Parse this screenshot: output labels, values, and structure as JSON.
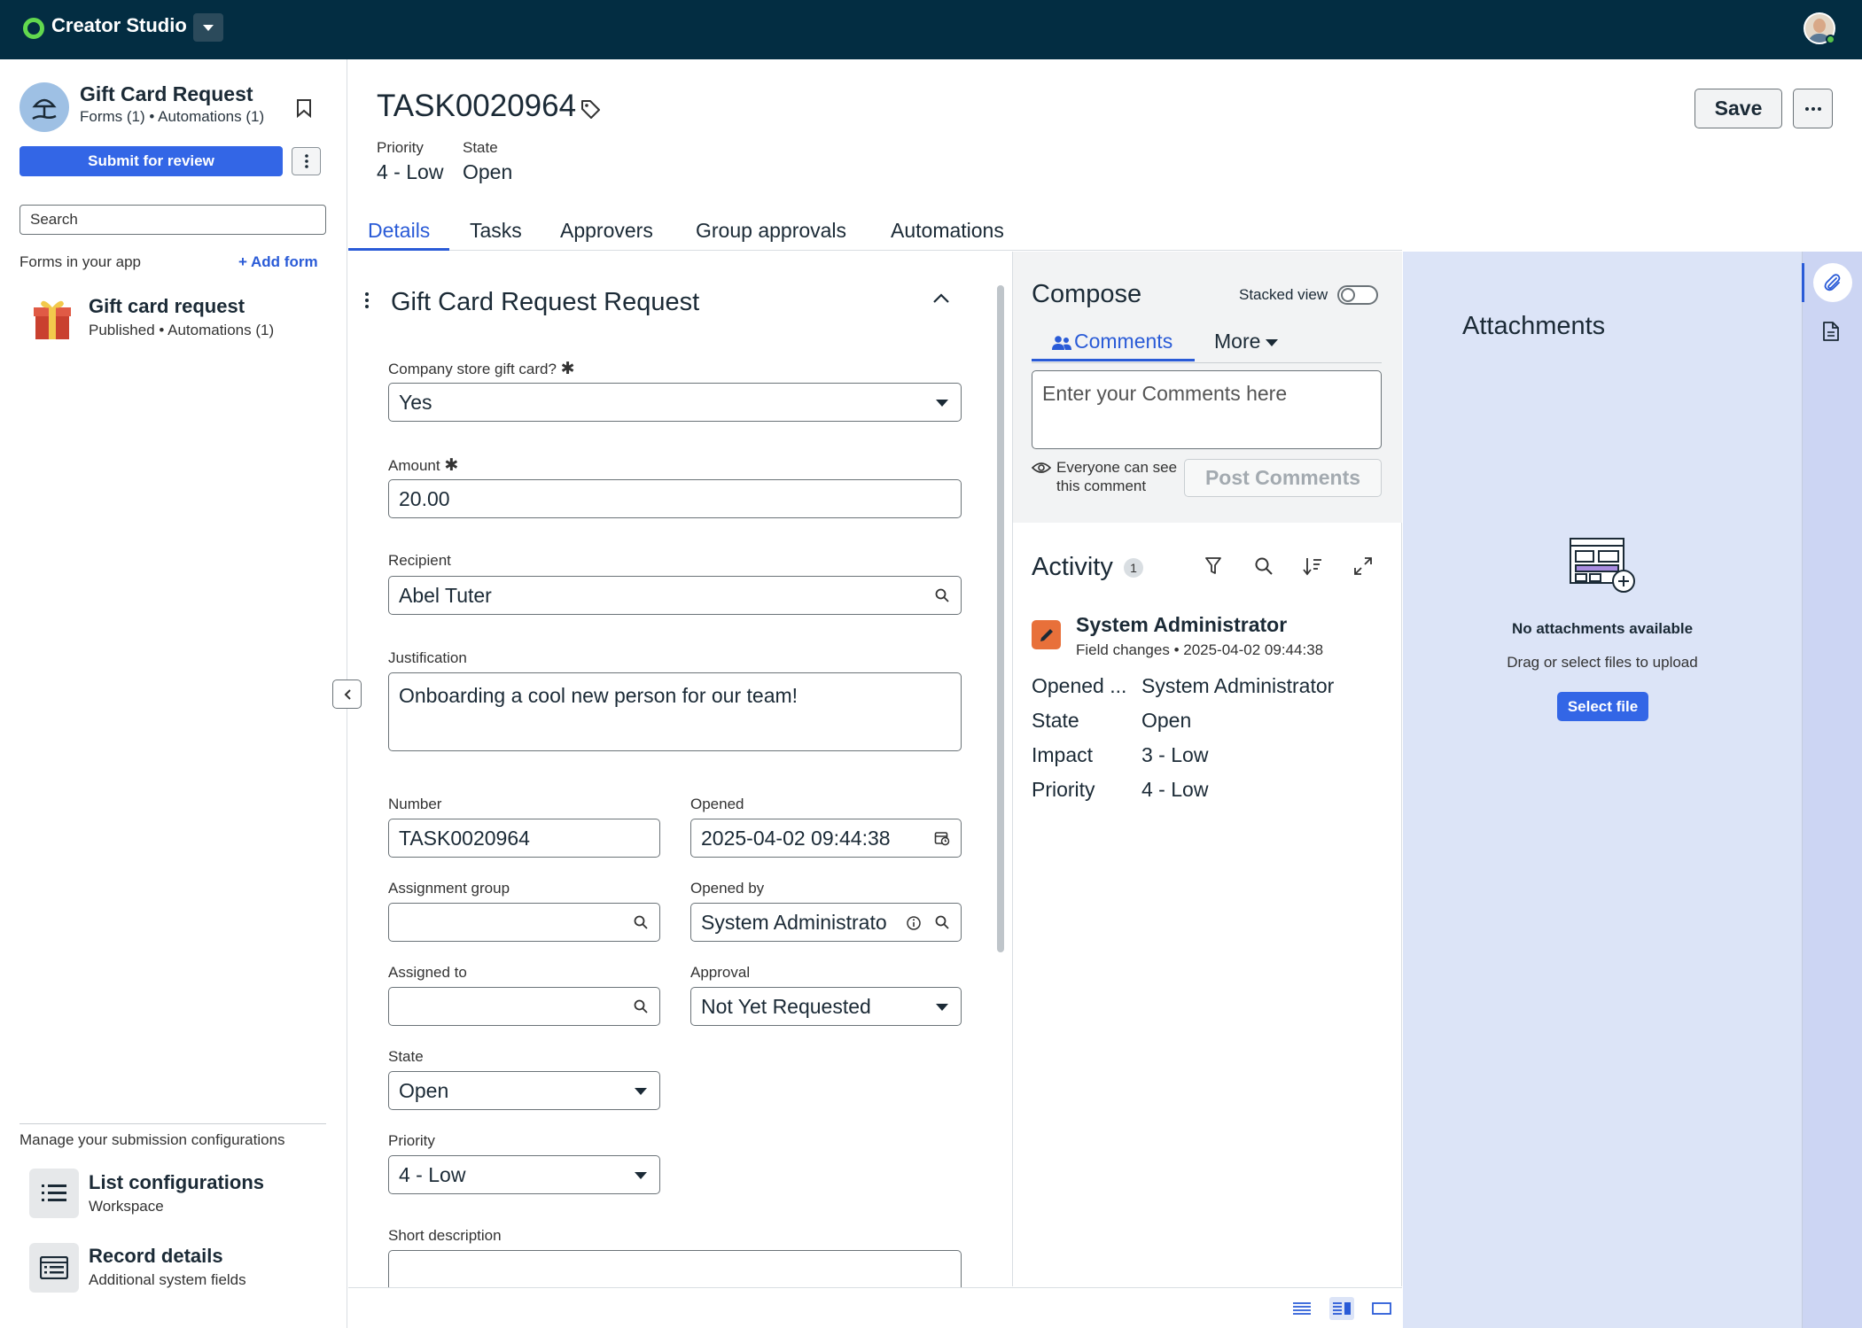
{
  "topbar": {
    "brand": "Creator Studio"
  },
  "sidebar": {
    "app_title": "Gift Card Request",
    "app_sub": "Forms (1) • Automations (1)",
    "submit_label": "Submit for review",
    "search_placeholder": "Search",
    "forms_label": "Forms in your app",
    "add_form_label": "+ Add form",
    "form_item": {
      "title": "Gift card request",
      "sub": "Published • Automations (1)"
    },
    "manage_label": "Manage your submission configurations",
    "configs": [
      {
        "title": "List configurations",
        "sub": "Workspace"
      },
      {
        "title": "Record details",
        "sub": "Additional system fields"
      }
    ]
  },
  "header": {
    "record_number": "TASK0020964",
    "priority_label": "Priority",
    "priority_value": "4 - Low",
    "state_label": "State",
    "state_value": "Open",
    "save_label": "Save",
    "more_label": "···"
  },
  "tabs": [
    "Details",
    "Tasks",
    "Approvers",
    "Group approvals",
    "Automations"
  ],
  "form": {
    "section_title": "Gift Card Request Request",
    "company_store": {
      "label": "Company store gift card?",
      "value": "Yes"
    },
    "amount": {
      "label": "Amount",
      "value": "20.00"
    },
    "recipient": {
      "label": "Recipient",
      "value": "Abel Tuter"
    },
    "justification": {
      "label": "Justification",
      "value": "Onboarding a cool new person for our team!"
    },
    "number": {
      "label": "Number",
      "value": "TASK0020964"
    },
    "opened": {
      "label": "Opened",
      "value": "2025-04-02 09:44:38"
    },
    "assignment_group": {
      "label": "Assignment group",
      "value": ""
    },
    "opened_by": {
      "label": "Opened by",
      "value": "System Administrato"
    },
    "assigned_to": {
      "label": "Assigned to",
      "value": ""
    },
    "approval": {
      "label": "Approval",
      "value": "Not Yet Requested"
    },
    "state": {
      "label": "State",
      "value": "Open"
    },
    "priority": {
      "label": "Priority",
      "value": "4 - Low"
    },
    "short_description": {
      "label": "Short description",
      "value": ""
    }
  },
  "compose": {
    "title": "Compose",
    "stacked_view_label": "Stacked view",
    "stacked_view_on": false,
    "tab_comments": "Comments",
    "tab_more": "More",
    "comment_placeholder": "Enter your Comments here",
    "visibility_line1": "Everyone can see",
    "visibility_line2": "this comment",
    "post_label": "Post Comments"
  },
  "activity": {
    "title": "Activity",
    "count": "1",
    "entry": {
      "author": "System Administrator",
      "meta": "Field changes • 2025-04-02 09:44:38",
      "changes": [
        {
          "field": "Opened ...",
          "value": "System Administrator"
        },
        {
          "field": "State",
          "value": "Open"
        },
        {
          "field": "Impact",
          "value": "3 - Low"
        },
        {
          "field": "Priority",
          "value": "4 - Low"
        }
      ]
    }
  },
  "attachments": {
    "title": "Attachments",
    "empty": "No attachments available",
    "hint": "Drag or select files to upload",
    "select_label": "Select file"
  },
  "colors": {
    "accent": "#2a5bd7",
    "topbar": "#032d42",
    "primary_button": "#3366e6",
    "attachments_bg": "#dce4f7"
  }
}
